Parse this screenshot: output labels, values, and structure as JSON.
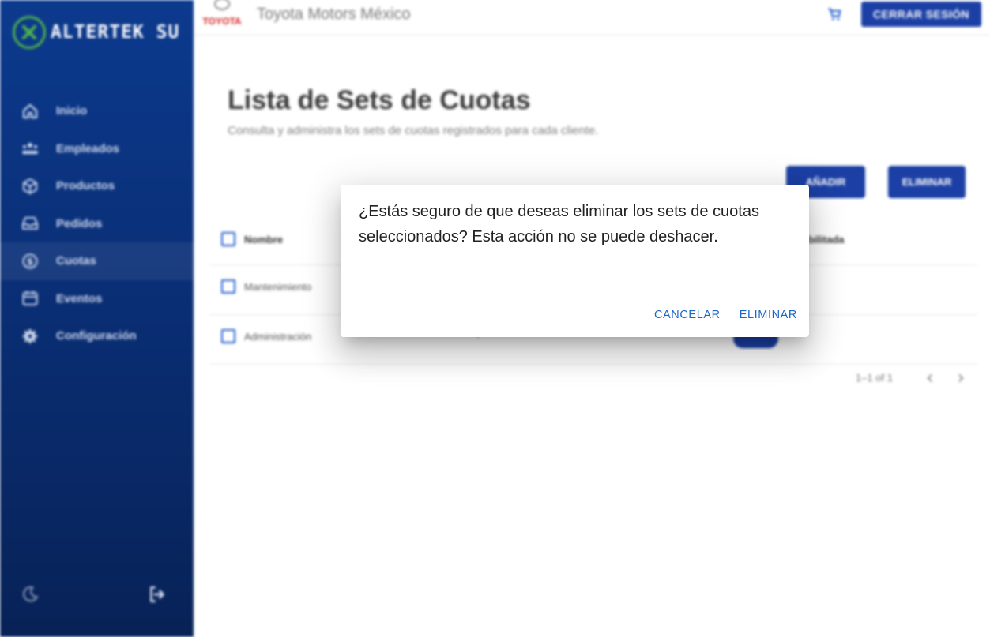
{
  "brand": {
    "name": "ALTERTEK SU",
    "accent_green": "#4fb34a"
  },
  "sidebar": {
    "items": [
      {
        "label": "Inicio",
        "icon": "home-icon"
      },
      {
        "label": "Empleados",
        "icon": "people-icon"
      },
      {
        "label": "Productos",
        "icon": "box-icon"
      },
      {
        "label": "Pedidos",
        "icon": "inbox-icon"
      },
      {
        "label": "Cuotas",
        "icon": "currency-exchange-icon",
        "active": true
      },
      {
        "label": "Eventos",
        "icon": "calendar-icon"
      },
      {
        "label": "Configuración",
        "icon": "gear-icon"
      }
    ],
    "footer": {
      "theme_icon": "moon-icon",
      "logout_icon": "logout-icon"
    },
    "colors": {
      "top": "#0c3a8e",
      "bottom": "#082257"
    }
  },
  "header": {
    "client_logo_text": "TOYOTA",
    "company": "Toyota Motors México",
    "cart_icon": "cart-icon",
    "logout_label": "CERRAR SESIÓN",
    "accent": "#1b3fa5"
  },
  "page": {
    "title": "Lista de Sets de Cuotas",
    "subtitle": "Consulta y administra los sets de cuotas registrados para cada cliente.",
    "add_label": "AÑADIR",
    "delete_label": "ELIMINAR"
  },
  "table": {
    "headers": {
      "name": "Nombre",
      "enabled_partial": "bilitada"
    },
    "rows": [
      {
        "name": "Mantenimiento"
      },
      {
        "name": "Administración",
        "marker": "-"
      }
    ],
    "pagination": "1–1 of 1"
  },
  "dialog": {
    "message": "¿Estás seguro de que deseas eliminar los sets de cuotas seleccionados? Esta acción no se puede deshacer.",
    "cancel_label": "CANCELAR",
    "confirm_label": "ELIMINAR",
    "action_color": "#1b66c9"
  }
}
